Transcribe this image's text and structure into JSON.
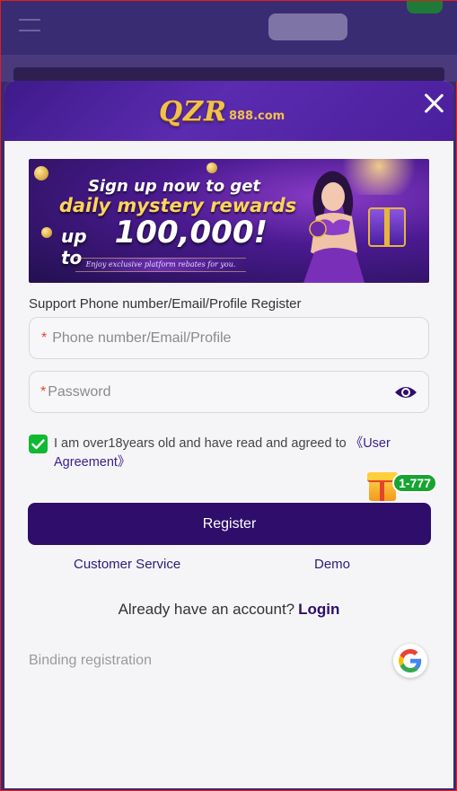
{
  "brand": {
    "logo_main": "QZR",
    "logo_sub": "888.com"
  },
  "promo": {
    "line1": "Sign up now to get",
    "line2": "daily mystery rewards",
    "line3_prefix": "up to",
    "line3_amount": "100,000!",
    "line4": "Enjoy exclusive platform rebates for you."
  },
  "form": {
    "support_label": "Support Phone number/Email/Profile Register",
    "phone_required_mark": "*",
    "phone_placeholder": "Phone number/Email/Profile",
    "password_required_mark": "*",
    "password_placeholder": "Password",
    "agreement_text": "I am over18years old and have read and agreed to ",
    "agreement_link": "《User Agreement》",
    "agreement_checked": true
  },
  "badge": {
    "label": "1-777"
  },
  "actions": {
    "register_label": "Register",
    "customer_service_label": "Customer Service",
    "demo_label": "Demo"
  },
  "login": {
    "prompt": "Already have an account?",
    "link_label": "Login"
  },
  "binding": {
    "label": "Binding registration"
  },
  "colors": {
    "header_purple": "#4a1f9c",
    "button_purple": "#2e0d6b",
    "check_green": "#10b931",
    "badge_green": "#16a530",
    "required_red": "#e04a2a"
  },
  "icons": {
    "close": "close-icon",
    "eye": "eye-icon",
    "check": "check-icon",
    "gift": "gift-icon",
    "google": "google-icon"
  }
}
